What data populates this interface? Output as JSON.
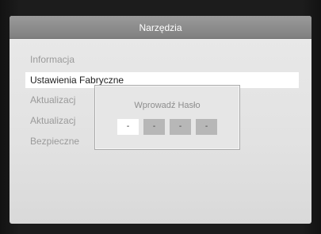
{
  "window": {
    "title": "Narzędzia"
  },
  "menu": {
    "items": [
      {
        "label": "Informacja"
      },
      {
        "label": "Ustawienia Fabryczne"
      },
      {
        "label": "Aktualizacj"
      },
      {
        "label": "Aktualizacj"
      },
      {
        "label": "Bezpieczne"
      }
    ],
    "selected_index": 1
  },
  "password_dialog": {
    "title": "Wprowadź Hasło",
    "digits": [
      "-",
      "-",
      "-",
      "-"
    ],
    "active_index": 0
  }
}
